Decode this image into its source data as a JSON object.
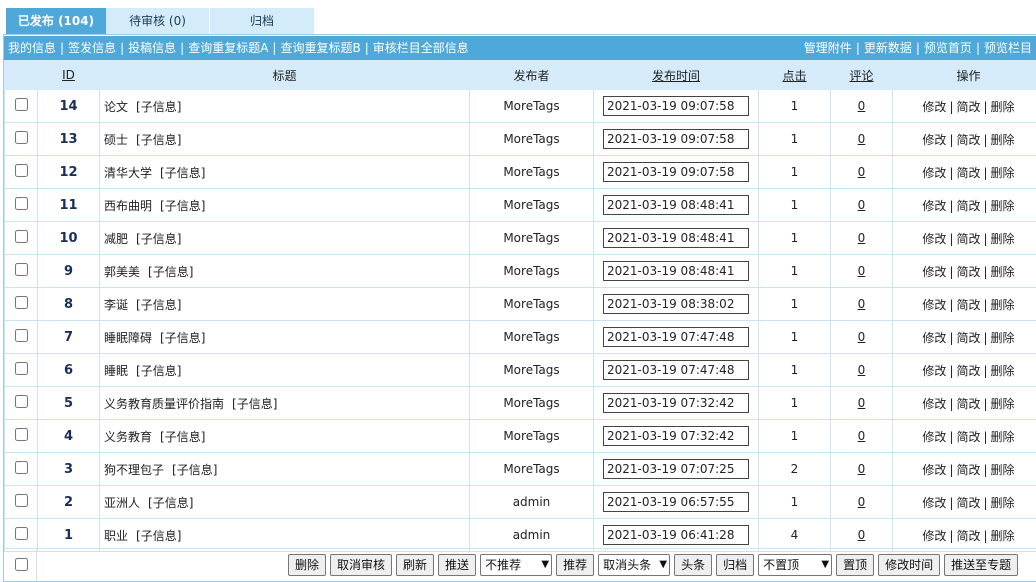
{
  "tabs": {
    "published": "已发布 (104)",
    "pending": "待审核 (0)",
    "archive": "归档"
  },
  "menu_left": [
    "我的信息",
    "签发信息",
    "投稿信息",
    "查询重复标题A",
    "查询重复标题B",
    "审核栏目全部信息"
  ],
  "menu_right": [
    "管理附件",
    "更新数据",
    "预览首页",
    "预览栏目"
  ],
  "columns": {
    "id": "ID",
    "title": "标题",
    "publisher": "发布者",
    "time": "发布时间",
    "clicks": "点击",
    "comments": "评论",
    "ops": "操作"
  },
  "sub_label": "[子信息]",
  "ops": {
    "edit": "修改",
    "simple": "简改",
    "delete": "删除"
  },
  "rows": [
    {
      "id": "14",
      "title": "论文",
      "publisher": "MoreTags",
      "time": "2021-03-19 09:07:58",
      "clicks": "1",
      "comments": "0"
    },
    {
      "id": "13",
      "title": "硕士",
      "publisher": "MoreTags",
      "time": "2021-03-19 09:07:58",
      "clicks": "1",
      "comments": "0"
    },
    {
      "id": "12",
      "title": "清华大学",
      "publisher": "MoreTags",
      "time": "2021-03-19 09:07:58",
      "clicks": "1",
      "comments": "0"
    },
    {
      "id": "11",
      "title": "西布曲明",
      "publisher": "MoreTags",
      "time": "2021-03-19 08:48:41",
      "clicks": "1",
      "comments": "0"
    },
    {
      "id": "10",
      "title": "减肥",
      "publisher": "MoreTags",
      "time": "2021-03-19 08:48:41",
      "clicks": "1",
      "comments": "0"
    },
    {
      "id": "9",
      "title": "郭美美",
      "publisher": "MoreTags",
      "time": "2021-03-19 08:48:41",
      "clicks": "1",
      "comments": "0"
    },
    {
      "id": "8",
      "title": "李诞",
      "publisher": "MoreTags",
      "time": "2021-03-19 08:38:02",
      "clicks": "1",
      "comments": "0"
    },
    {
      "id": "7",
      "title": "睡眠障碍",
      "publisher": "MoreTags",
      "time": "2021-03-19 07:47:48",
      "clicks": "1",
      "comments": "0"
    },
    {
      "id": "6",
      "title": "睡眠",
      "publisher": "MoreTags",
      "time": "2021-03-19 07:47:48",
      "clicks": "1",
      "comments": "0"
    },
    {
      "id": "5",
      "title": "义务教育质量评价指南",
      "publisher": "MoreTags",
      "time": "2021-03-19 07:32:42",
      "clicks": "1",
      "comments": "0"
    },
    {
      "id": "4",
      "title": "义务教育",
      "publisher": "MoreTags",
      "time": "2021-03-19 07:32:42",
      "clicks": "1",
      "comments": "0"
    },
    {
      "id": "3",
      "title": "狗不理包子",
      "publisher": "MoreTags",
      "time": "2021-03-19 07:07:25",
      "clicks": "2",
      "comments": "0"
    },
    {
      "id": "2",
      "title": "亚洲人",
      "publisher": "admin",
      "time": "2021-03-19 06:57:55",
      "clicks": "1",
      "comments": "0"
    },
    {
      "id": "1",
      "title": "职业",
      "publisher": "admin",
      "time": "2021-03-19 06:41:28",
      "clicks": "4",
      "comments": "0"
    }
  ],
  "actions": {
    "delete": "删除",
    "cancel_review": "取消审核",
    "refresh": "刷新",
    "push": "推送",
    "recommend_select": "不推荐",
    "recommend": "推荐",
    "headline_select": "取消头条",
    "headline": "头条",
    "archive": "归档",
    "top_select": "不置顶",
    "top": "置顶",
    "modify_time": "修改时间",
    "push_topic": "推送至专题"
  }
}
